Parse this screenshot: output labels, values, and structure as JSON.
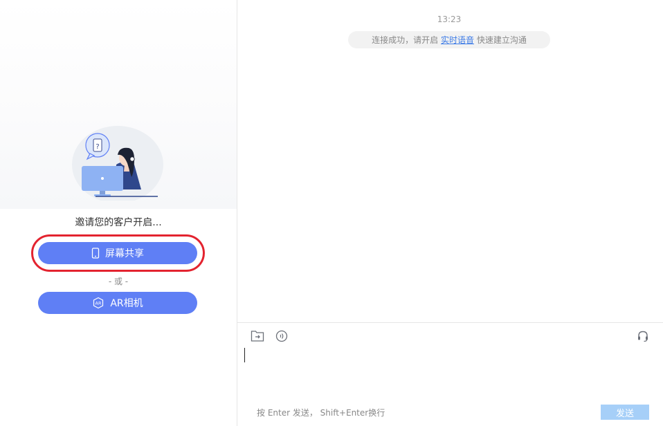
{
  "left_panel": {
    "invite_text": "邀请您的客户开启...",
    "screen_share_button": "屏幕共享",
    "or_text": "- 或 -",
    "ar_camera_button": "AR相机",
    "ar_badge": "AR",
    "question_mark": "?"
  },
  "chat": {
    "timestamp": "13:23",
    "notice_prefix": "连接成功，请开启 ",
    "notice_link": "实时语音",
    "notice_suffix": " 快速建立沟通"
  },
  "composer": {
    "hint": "按 Enter 发送， Shift+Enter换行",
    "send_label": "发送",
    "value": ""
  },
  "colors": {
    "primary": "#5f7ff5",
    "highlight": "#e3232f",
    "link": "#3d7be6",
    "send_disabled": "#a6cff8"
  },
  "icons": {
    "screen_share": "phone-icon",
    "ar_camera": "ar-camera-icon",
    "folder": "folder-icon",
    "voice": "voice-icon",
    "headset": "headset-icon"
  }
}
